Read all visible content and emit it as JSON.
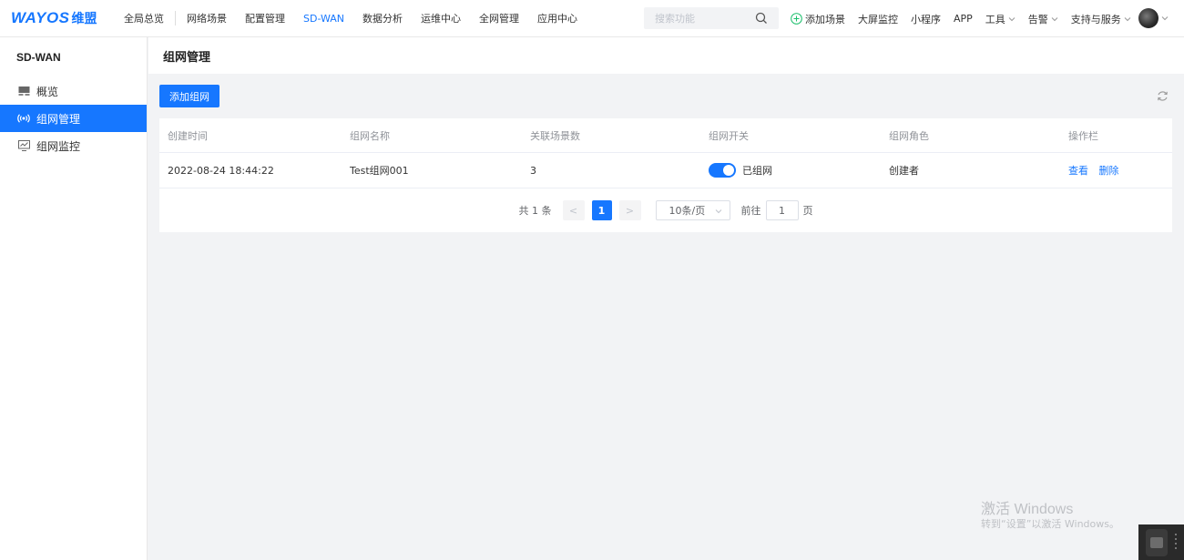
{
  "brand": {
    "logo_text": "WAYOS",
    "logo_cn": "维盟"
  },
  "nav": {
    "items": [
      "全局总览",
      "网络场景",
      "配置管理",
      "SD-WAN",
      "数据分析",
      "运维中心",
      "全网管理",
      "应用中心"
    ],
    "active": "SD-WAN"
  },
  "search": {
    "placeholder": "搜索功能"
  },
  "right_nav": {
    "add_scene": "添加场景",
    "big_screen": "大屏监控",
    "mini_program": "小程序",
    "app": "APP",
    "tools": "工具",
    "alarm": "告警",
    "support": "支持与服务"
  },
  "sidebar": {
    "title": "SD-WAN",
    "items": [
      {
        "label": "概览",
        "icon": "overview-icon"
      },
      {
        "label": "组网管理",
        "icon": "network-signal-icon",
        "active": true
      },
      {
        "label": "组网监控",
        "icon": "monitor-icon"
      }
    ]
  },
  "page": {
    "title": "组网管理",
    "add_button": "添加组网"
  },
  "table": {
    "columns": [
      "创建时间",
      "组网名称",
      "关联场景数",
      "组网开关",
      "组网角色",
      "操作栏"
    ],
    "rows": [
      {
        "created": "2022-08-24 18:44:22",
        "name": "Test组网001",
        "scenes": "3",
        "switch_label": "已组网",
        "switch_on": true,
        "role": "创建者",
        "actions": [
          "查看",
          "删除"
        ]
      }
    ]
  },
  "pagination": {
    "total": "共 1 条",
    "prev": "<",
    "current": "1",
    "next": ">",
    "page_size": "10条/页",
    "goto_label": "前往",
    "goto_value": "1",
    "goto_unit": "页"
  },
  "watermark": {
    "line1": "激活 Windows",
    "line2": "转到“设置”以激活 Windows。"
  },
  "colors": {
    "accent": "#1677ff",
    "background": "#f2f3f5"
  }
}
